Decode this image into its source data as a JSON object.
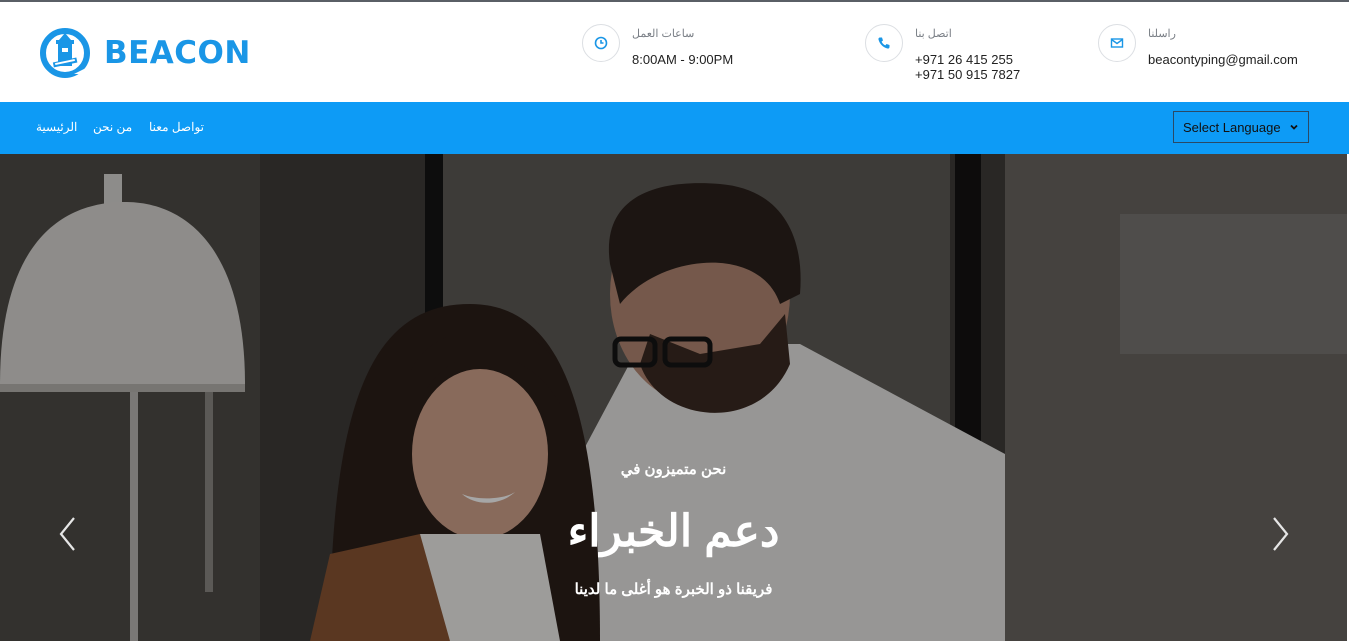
{
  "brand": {
    "name": "BEACON",
    "color": "#1a96e6"
  },
  "contacts": {
    "hours": {
      "label": "ساعات العمل",
      "value": "8:00AM - 9:00PM",
      "icon": "clock-icon"
    },
    "phone": {
      "label": "اتصل بنا",
      "value1": "+971 26 415 255",
      "value2": "+971 50 915 7827",
      "icon": "phone-icon"
    },
    "email": {
      "label": "راسلنا",
      "value": "beacontyping@gmail.com",
      "icon": "envelope-icon"
    }
  },
  "nav": {
    "background": "#0d9bf6",
    "items": [
      {
        "label": "الرئيسية"
      },
      {
        "label": "من نحن"
      },
      {
        "label": "تواصل معنا"
      }
    ],
    "language_select": "Select Language"
  },
  "hero": {
    "subtitle": "نحن متميزون في",
    "title": "دعم الخبراء",
    "description": "فريقنا ذو الخبرة هو أغلى ما لدينا"
  }
}
